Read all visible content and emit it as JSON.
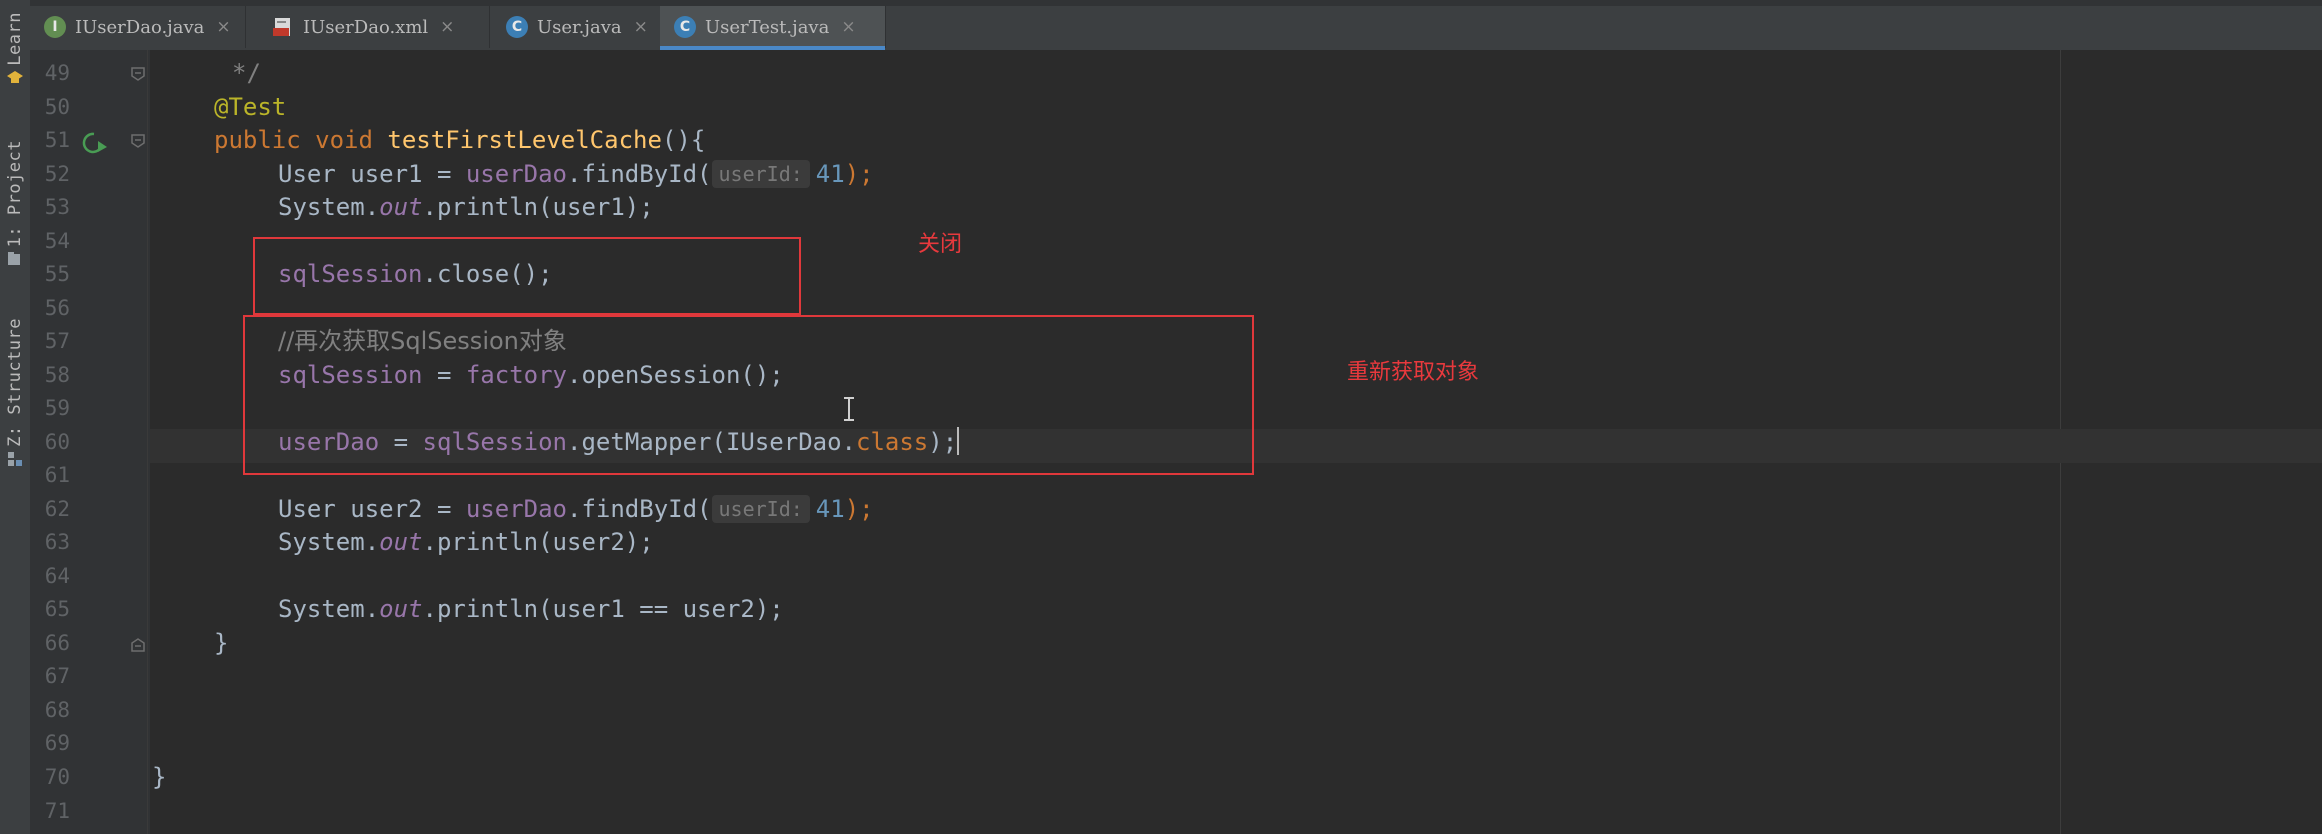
{
  "tool_strip": {
    "learn_label": "Learn",
    "project_label": "1: Project",
    "structure_label": "Z: Structure"
  },
  "tabs": [
    {
      "label": "IUserDao.java",
      "icon": "interface-icon",
      "active": false
    },
    {
      "label": "IUserDao.xml",
      "icon": "xml-file-icon",
      "active": false
    },
    {
      "label": "User.java",
      "icon": "class-icon",
      "active": false
    },
    {
      "label": "UserTest.java",
      "icon": "class-icon",
      "active": true
    }
  ],
  "tab_close_glyph": "×",
  "file_icon_letters": {
    "interface": "I",
    "class": "C"
  },
  "line_numbers": [
    "49",
    "50",
    "51",
    "52",
    "53",
    "54",
    "55",
    "56",
    "57",
    "58",
    "59",
    "60",
    "61",
    "62",
    "63",
    "64",
    "65",
    "66",
    "67",
    "68",
    "69",
    "70",
    "71"
  ],
  "code": {
    "l49": "*/",
    "l50": "@Test",
    "l51_kw": "public void ",
    "l51_name": "testFirstLevelCache",
    "l51_rest": "(){",
    "l52_a": "User user1 = ",
    "l52_field": "userDao",
    "l52_b": ".findById(",
    "l52_hint": "userId:",
    "l52_num": "41",
    "l52_c": ");",
    "l53_a": "System.",
    "l53_static": "out",
    "l53_b": ".println(user1);",
    "l55_field": "sqlSession",
    "l55_b": ".close();",
    "l57_a": "//再次获取SqlSession对象",
    "l58_field": "sqlSession",
    "l58_b": " = ",
    "l58_field2": "factory",
    "l58_c": ".openSession();",
    "l60_field": "userDao",
    "l60_b": " = ",
    "l60_field2": "sqlSession",
    "l60_c": ".getMapper(IUserDao.",
    "l60_kw": "class",
    "l60_d": ");",
    "l62_a": "User user2 = ",
    "l62_field": "userDao",
    "l62_b": ".findById(",
    "l62_hint": "userId:",
    "l62_num": "41",
    "l62_c": ");",
    "l63_a": "System.",
    "l63_static": "out",
    "l63_b": ".println(user2);",
    "l65_a": "System.",
    "l65_static": "out",
    "l65_b": ".println(user1 == user2);",
    "l66": "}",
    "l70": "}"
  },
  "annotations": {
    "close_label": "关闭",
    "reacquire_label": "重新获取对象"
  },
  "colors": {
    "annotation_red": "#e0383b",
    "active_tab_underline": "#4a88c7"
  }
}
